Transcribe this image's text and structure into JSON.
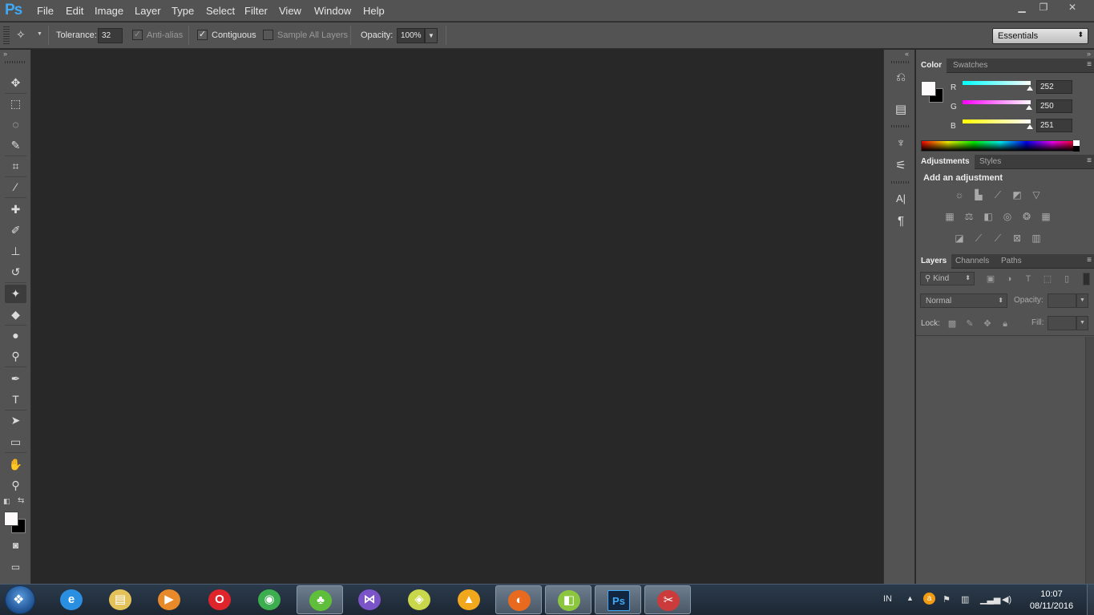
{
  "app": {
    "logo": "Ps"
  },
  "menu": [
    "File",
    "Edit",
    "Image",
    "Layer",
    "Type",
    "Select",
    "Filter",
    "View",
    "Window",
    "Help"
  ],
  "window_controls": {
    "minimize": "minimize-icon",
    "restore": "restore-icon",
    "close": "close-icon"
  },
  "options_bar": {
    "tool_icon": "magic-wand-icon",
    "tolerance_label": "Tolerance:",
    "tolerance_value": "32",
    "antialias_label": "Anti-alias",
    "antialias_checked": true,
    "contiguous_label": "Contiguous",
    "contiguous_checked": true,
    "sample_all_label": "Sample All Layers",
    "sample_all_checked": false,
    "opacity_label": "Opacity:",
    "opacity_value": "100%",
    "workspace": "Essentials"
  },
  "tools": [
    {
      "name": "move-tool-icon",
      "glyph": "✥"
    },
    {
      "name": "marquee-tool-icon",
      "glyph": "⬚"
    },
    {
      "name": "lasso-tool-icon",
      "glyph": "◌"
    },
    {
      "name": "quick-selection-tool-icon",
      "glyph": "✎"
    },
    {
      "name": "crop-tool-icon",
      "glyph": "⌗"
    },
    {
      "name": "eyedropper-tool-icon",
      "glyph": "⁄"
    },
    {
      "name": "healing-brush-tool-icon",
      "glyph": "✚"
    },
    {
      "name": "brush-tool-icon",
      "glyph": "✐"
    },
    {
      "name": "clone-stamp-tool-icon",
      "glyph": "⊥"
    },
    {
      "name": "history-brush-tool-icon",
      "glyph": "↺"
    },
    {
      "name": "eraser-tool-icon",
      "glyph": "✦"
    },
    {
      "name": "paint-bucket-tool-icon",
      "glyph": "◆"
    },
    {
      "name": "blur-tool-icon",
      "glyph": "●"
    },
    {
      "name": "dodge-tool-icon",
      "glyph": "⚲"
    },
    {
      "name": "pen-tool-icon",
      "glyph": "✒"
    },
    {
      "name": "type-tool-icon",
      "glyph": "T"
    },
    {
      "name": "path-selection-tool-icon",
      "glyph": "➤"
    },
    {
      "name": "rectangle-tool-icon",
      "glyph": "▭"
    },
    {
      "name": "hand-tool-icon",
      "glyph": "✋"
    },
    {
      "name": "zoom-tool-icon",
      "glyph": "⚲"
    }
  ],
  "mini_dock": [
    {
      "name": "history-panel-icon",
      "glyph": "⎌"
    },
    {
      "name": "properties-panel-icon",
      "glyph": "▤"
    },
    {
      "name": "brush-presets-panel-icon",
      "glyph": "♆"
    },
    {
      "name": "brush-panel-icon",
      "glyph": "⚟"
    },
    {
      "name": "character-panel-icon",
      "glyph": "A|"
    },
    {
      "name": "paragraph-panel-icon",
      "glyph": "¶"
    }
  ],
  "color_panel": {
    "tabs": [
      "Color",
      "Swatches"
    ],
    "channels": [
      {
        "label": "R",
        "value": "252",
        "fraction": 0.988,
        "grad": "linear-gradient(90deg,#00ffff,#fbfafb)"
      },
      {
        "label": "G",
        "value": "250",
        "fraction": 0.98,
        "grad": "linear-gradient(90deg,#ff00ff,#fbfafb)"
      },
      {
        "label": "B",
        "value": "251",
        "fraction": 0.984,
        "grad": "linear-gradient(90deg,#ffff00,#fbfafb)"
      }
    ],
    "foreground": "#fcfafb",
    "background": "#000000"
  },
  "adjustments_panel": {
    "tabs": [
      "Adjustments",
      "Styles"
    ],
    "heading": "Add an adjustment",
    "rows": [
      [
        {
          "name": "brightness-contrast-icon",
          "glyph": "☼"
        },
        {
          "name": "levels-icon",
          "glyph": "▙"
        },
        {
          "name": "curves-icon",
          "glyph": "⟋"
        },
        {
          "name": "exposure-icon",
          "glyph": "◩"
        },
        {
          "name": "vibrance-icon",
          "glyph": "▽"
        }
      ],
      [
        {
          "name": "hue-saturation-icon",
          "glyph": "▦"
        },
        {
          "name": "color-balance-icon",
          "glyph": "⚖"
        },
        {
          "name": "black-white-icon",
          "glyph": "◧"
        },
        {
          "name": "photo-filter-icon",
          "glyph": "◎"
        },
        {
          "name": "channel-mixer-icon",
          "glyph": "❂"
        },
        {
          "name": "color-lookup-icon",
          "glyph": "▦"
        }
      ],
      [
        {
          "name": "invert-icon",
          "glyph": "◪"
        },
        {
          "name": "posterize-icon",
          "glyph": "⟋"
        },
        {
          "name": "threshold-icon",
          "glyph": "⟋"
        },
        {
          "name": "selective-color-icon",
          "glyph": "⊠"
        },
        {
          "name": "gradient-map-icon",
          "glyph": "▥"
        }
      ]
    ]
  },
  "layers_panel": {
    "tabs": [
      "Layers",
      "Channels",
      "Paths"
    ],
    "filter_label": "Kind",
    "blend_mode": "Normal",
    "opacity_label": "Opacity:",
    "lock_label": "Lock:",
    "fill_label": "Fill:"
  },
  "taskbar": {
    "apps": [
      {
        "name": "internet-explorer-icon",
        "glyph": "e",
        "color": "#2a8fe0",
        "open": false
      },
      {
        "name": "file-explorer-icon",
        "glyph": "▤",
        "color": "#e3c25a",
        "open": false
      },
      {
        "name": "media-player-icon",
        "glyph": "▶",
        "color": "#e88a2a",
        "open": false
      },
      {
        "name": "opera-icon",
        "glyph": "O",
        "color": "#e0242c",
        "open": false
      },
      {
        "name": "chrome-icon",
        "glyph": "◉",
        "color": "#3cae4f",
        "open": false
      },
      {
        "name": "clover-icon",
        "glyph": "♣",
        "color": "#5fbf3a",
        "open": true
      },
      {
        "name": "visual-studio-icon",
        "glyph": "⋈",
        "color": "#7a54c8",
        "open": false
      },
      {
        "name": "sticky-notes-icon",
        "glyph": "◈",
        "color": "#c9d84a",
        "open": false
      },
      {
        "name": "aimp-icon",
        "glyph": "▲",
        "color": "#f2a81d",
        "open": false
      },
      {
        "name": "firefox-icon",
        "glyph": "◐",
        "color": "#e86a1f",
        "open": true
      },
      {
        "name": "green-app-icon",
        "glyph": "◧",
        "color": "#8cc63e",
        "open": true
      },
      {
        "name": "photoshop-taskbar-icon",
        "glyph": "Ps",
        "color": "#13263f",
        "open": true
      },
      {
        "name": "snipping-tool-icon",
        "glyph": "✂",
        "color": "#cc3b3b",
        "open": true
      }
    ],
    "language": "IN",
    "time": "10:07",
    "date": "08/11/2016"
  }
}
